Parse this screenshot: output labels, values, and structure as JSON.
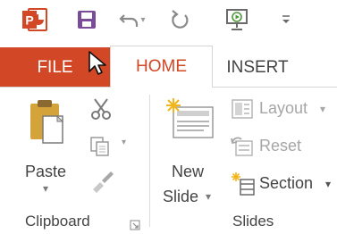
{
  "qat": {
    "app_icon": "powerpoint-icon",
    "save_icon": "save-icon",
    "undo_icon": "undo-icon",
    "redo_icon": "redo-icon",
    "presentation_icon": "start-from-beginning-icon",
    "customize_icon": "customize-toolbar-icon",
    "caret": "▾"
  },
  "tabs": {
    "file": "FILE",
    "home": "HOME",
    "insert": "INSERT"
  },
  "clipboard": {
    "paste_label": "Paste",
    "paste_caret": "▾",
    "group_label": "Clipboard",
    "cut_icon": "scissors-icon",
    "copy_icon": "copy-icon",
    "format_painter_icon": "brush-icon",
    "dialog_launcher_icon": "dialog-launcher-icon"
  },
  "slides": {
    "new_slide_line1": "New",
    "new_slide_line2": "Slide",
    "new_slide_caret": "▾",
    "layout_label": "Layout",
    "layout_caret": "▾",
    "reset_label": "Reset",
    "section_label": "Section",
    "section_caret": "▾",
    "group_label": "Slides"
  },
  "colors": {
    "accent": "#d24726",
    "text": "#444444",
    "disabled": "#a6a6a6"
  }
}
